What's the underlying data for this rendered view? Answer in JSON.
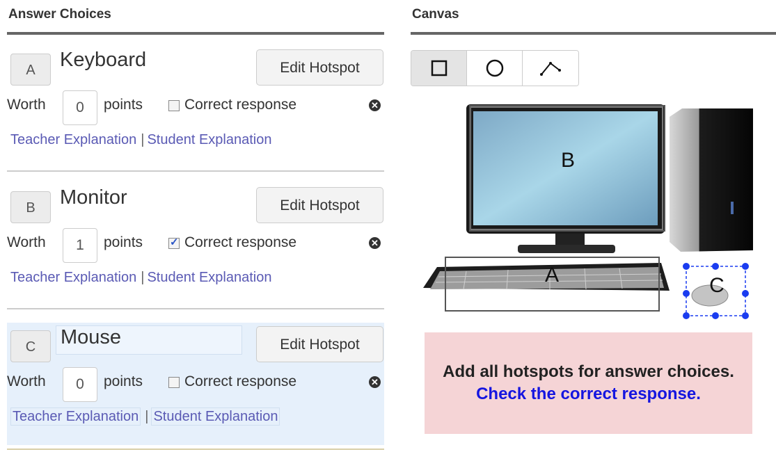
{
  "left_title": "Answer Choices",
  "right_title": "Canvas",
  "edit_hotspot_label": "Edit Hotspot",
  "worth_label": "Worth",
  "points_label": "points",
  "correct_label": "Correct response",
  "teacher_link": "Teacher Explanation",
  "link_separator": "|",
  "student_link": "Student Explanation",
  "choices": [
    {
      "letter": "A",
      "name": "Keyboard",
      "points": "0",
      "correct": false
    },
    {
      "letter": "B",
      "name": "Monitor",
      "points": "1",
      "correct": true
    },
    {
      "letter": "C",
      "name": "Mouse",
      "points": "0",
      "correct": false
    }
  ],
  "tools": [
    "rectangle-tool",
    "circle-tool",
    "polygon-tool"
  ],
  "canvas_labels": {
    "a": "A",
    "b": "B",
    "c": "C"
  },
  "alert": {
    "text": "Add all hotspots for answer choices.",
    "link": "Check the correct response."
  },
  "colors": {
    "link": "#5a5ab4",
    "selected_bg": "#e6f0fb",
    "alert_bg": "#f5d4d6",
    "hotspot_handle": "#1a3cf0"
  }
}
